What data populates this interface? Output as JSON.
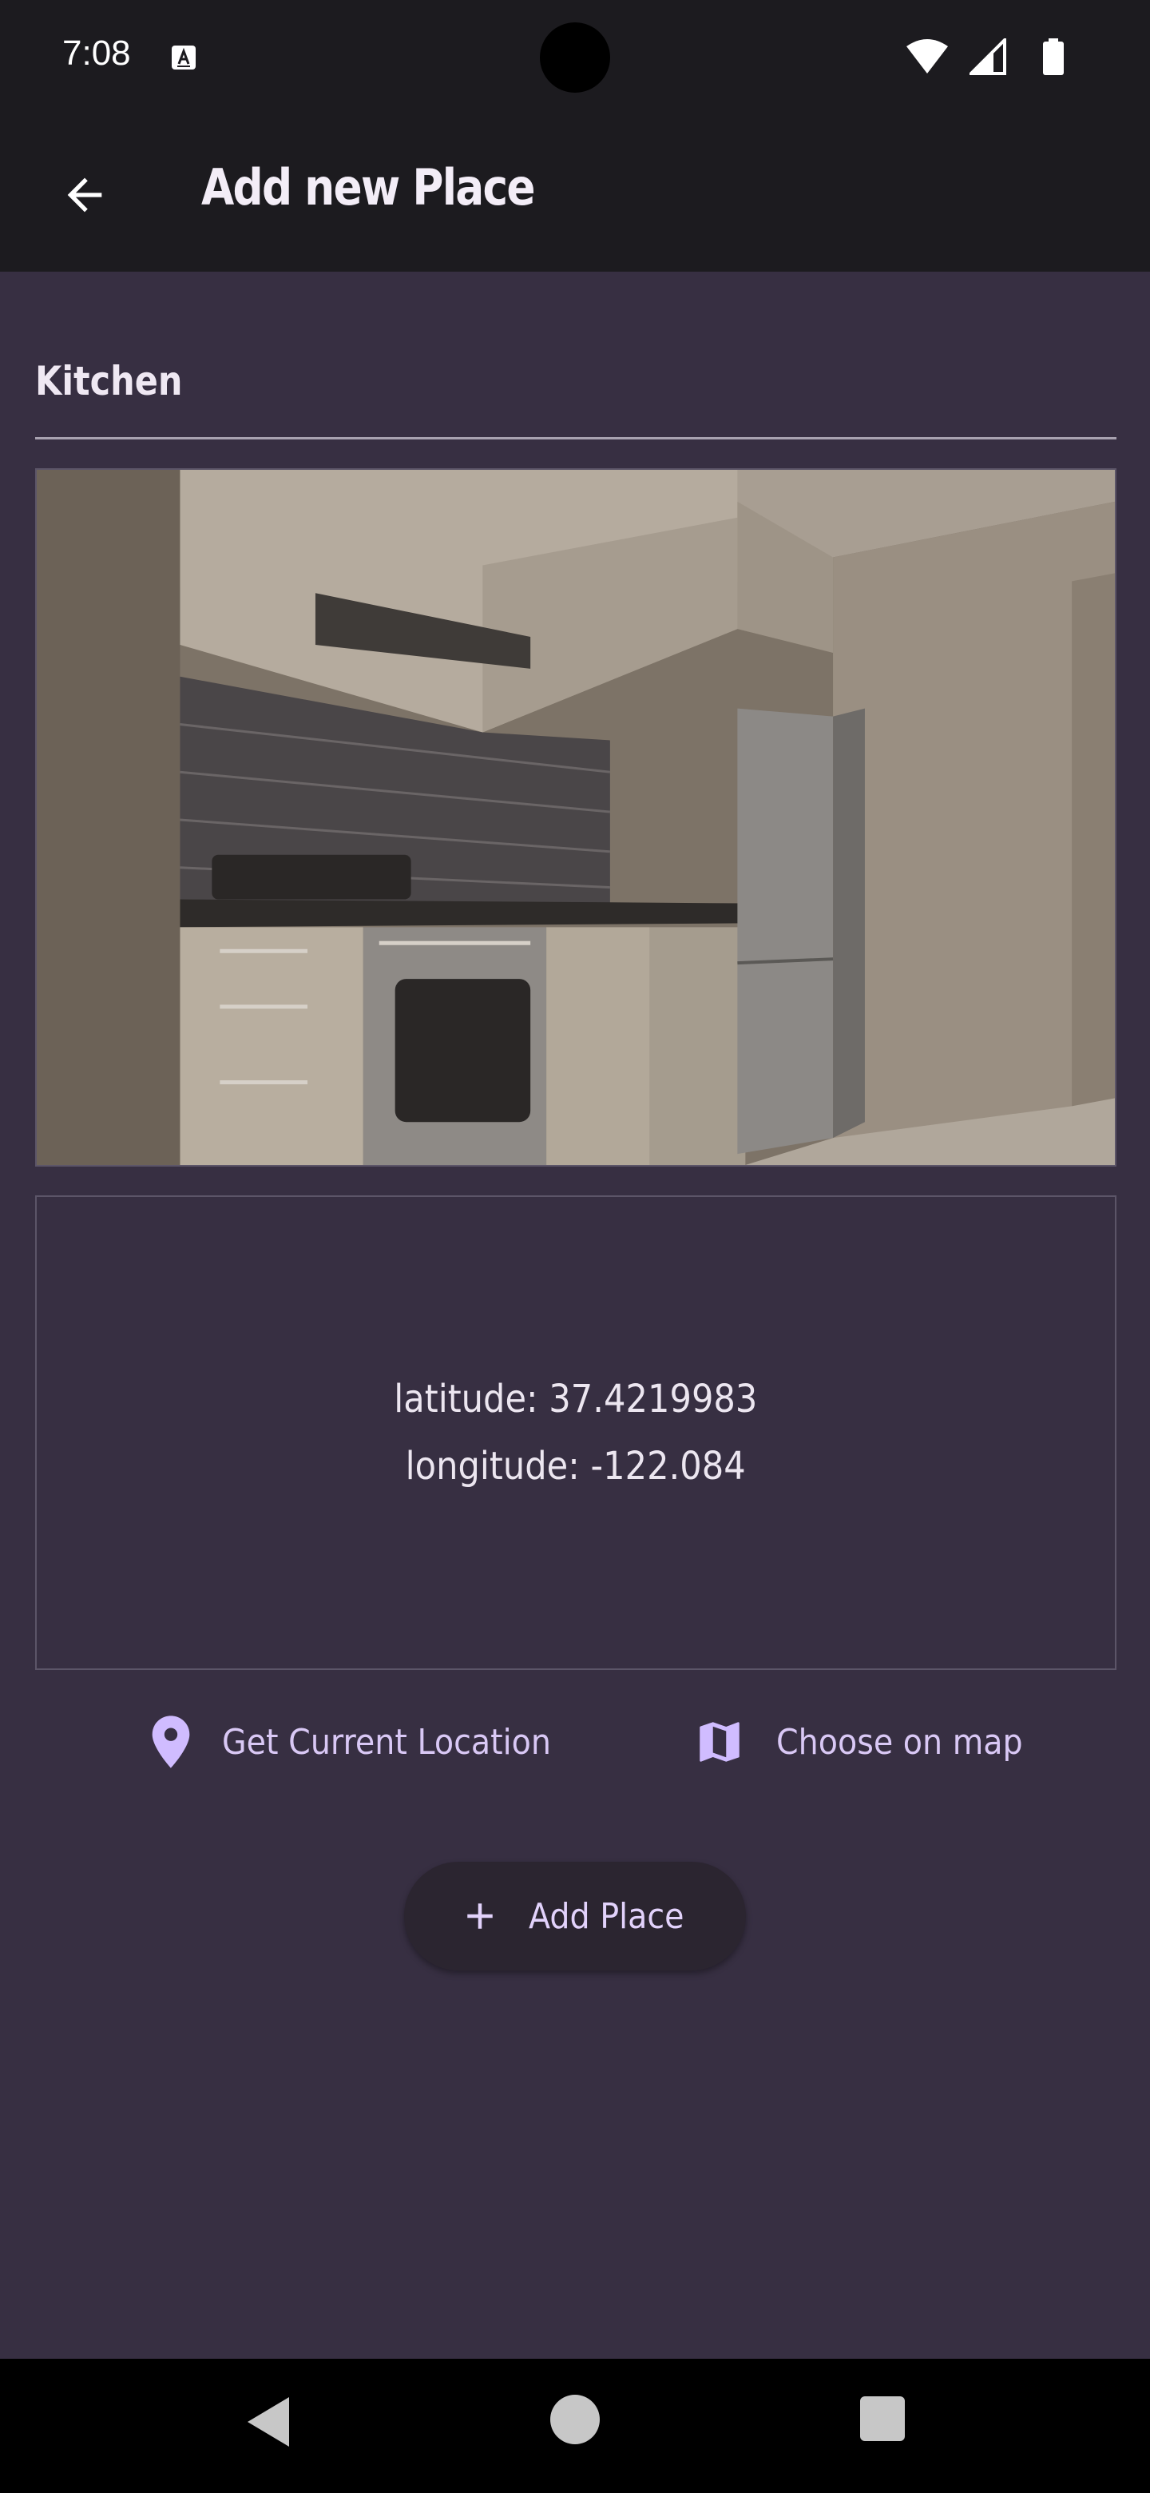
{
  "status_bar": {
    "time": "7:08",
    "icons": [
      "a-notification-icon",
      "wifi-icon",
      "signal-icon",
      "battery-icon"
    ]
  },
  "app_bar": {
    "title": "Add new Place",
    "back_icon": "arrow-back-icon"
  },
  "form": {
    "title_value": "Kitchen",
    "image_description_icon": "kitchen-photo"
  },
  "location": {
    "latitude_text": "latitude: 37.4219983",
    "longitude_text": "longitude: -122.084"
  },
  "actions": {
    "current_location_label": "Get Current Location",
    "current_location_icon": "location-pin-icon",
    "choose_map_label": "Choose on map",
    "choose_map_icon": "map-icon"
  },
  "fab": {
    "label": "Add Place",
    "icon": "plus-icon"
  },
  "nav": {
    "icons": [
      "nav-back-icon",
      "nav-home-icon",
      "nav-recents-icon"
    ]
  },
  "colors": {
    "background": "#372f42",
    "app_bar": "#1c1b1f",
    "accent": "#d0bcff"
  }
}
